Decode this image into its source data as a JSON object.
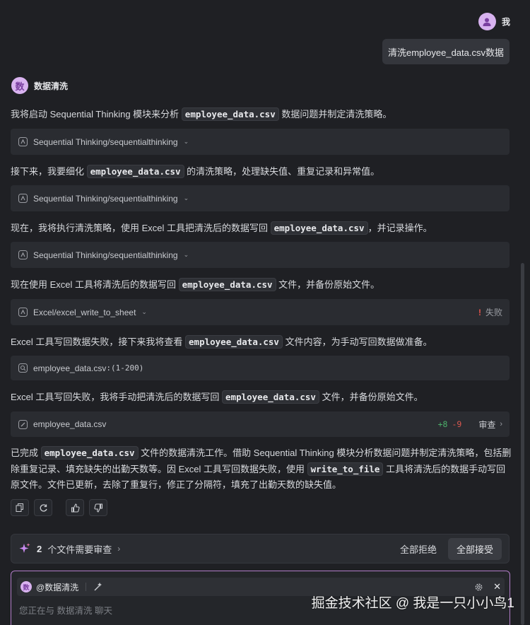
{
  "user": {
    "name": "我",
    "message": "清洗employee_data.csv数据"
  },
  "bot": {
    "avatar_char": "数",
    "name": "数据清洗"
  },
  "messages": {
    "m1": {
      "a": "我将启动 Sequential Thinking 模块来分析 ",
      "code": "employee_data.csv",
      "b": " 数据问题并制定清洗策略。"
    },
    "m2": {
      "a": "接下来，我要细化 ",
      "code": "employee_data.csv",
      "b": " 的清洗策略，处理缺失值、重复记录和异常值。"
    },
    "m3": {
      "a": "现在，我将执行清洗策略，使用 Excel 工具把清洗后的数据写回 ",
      "code": "employee_data.csv",
      "b": "，并记录操作。"
    },
    "m4": {
      "a": "现在使用 Excel 工具将清洗后的数据写回 ",
      "code": "employee_data.csv",
      "b": " 文件，并备份原始文件。"
    },
    "m5": {
      "a": "Excel 工具写回数据失败，接下来我将查看 ",
      "code": "employee_data.csv",
      "b": " 文件内容，为手动写回数据做准备。"
    },
    "m6": {
      "a": "Excel 工具写回失败，我将手动把清洗后的数据写回 ",
      "code": "employee_data.csv",
      "b": " 文件，并备份原始文件。"
    },
    "final": {
      "a": "已完成 ",
      "code1": "employee_data.csv",
      "b": " 文件的数据清洗工作。借助 Sequential Thinking 模块分析数据问题并制定清洗策略，包括删除重复记录、填充缺失的出勤天数等。因 Excel 工具写回数据失败，使用 ",
      "code2": "write_to_file",
      "c": " 工具将清洗后的数据手动写回原文件。文件已更新，去除了重复行，修正了分隔符，填充了出勤天数的缺失值。"
    }
  },
  "tools": {
    "t1": {
      "label": "Sequential Thinking/sequentialthinking"
    },
    "t2": {
      "label": "Sequential Thinking/sequentialthinking"
    },
    "t3": {
      "label": "Sequential Thinking/sequentialthinking"
    },
    "t4": {
      "label": "Excel/excel_write_to_sheet",
      "status_mark": "!",
      "status": "失败"
    },
    "t5": {
      "label": "employee_data.csv",
      "range": ":(1-200)"
    },
    "t6": {
      "label": "employee_data.csv",
      "added": "+8",
      "removed": "-9",
      "review": "审查"
    }
  },
  "review_bar": {
    "count": "2",
    "text": "个文件需要审查",
    "reject": "全部拒绝",
    "accept": "全部接受"
  },
  "input": {
    "chip_avatar": "数",
    "chip_label": "@数据清洗",
    "placeholder": "您正在与 数据清洗 聊天"
  },
  "watermark": "掘金技术社区 @ 我是一只小小鸟1",
  "colors": {
    "background": "#1f2024",
    "accent": "#b27dc8",
    "fail": "#e5534b",
    "added": "#4cae6a",
    "removed": "#d9574f"
  }
}
